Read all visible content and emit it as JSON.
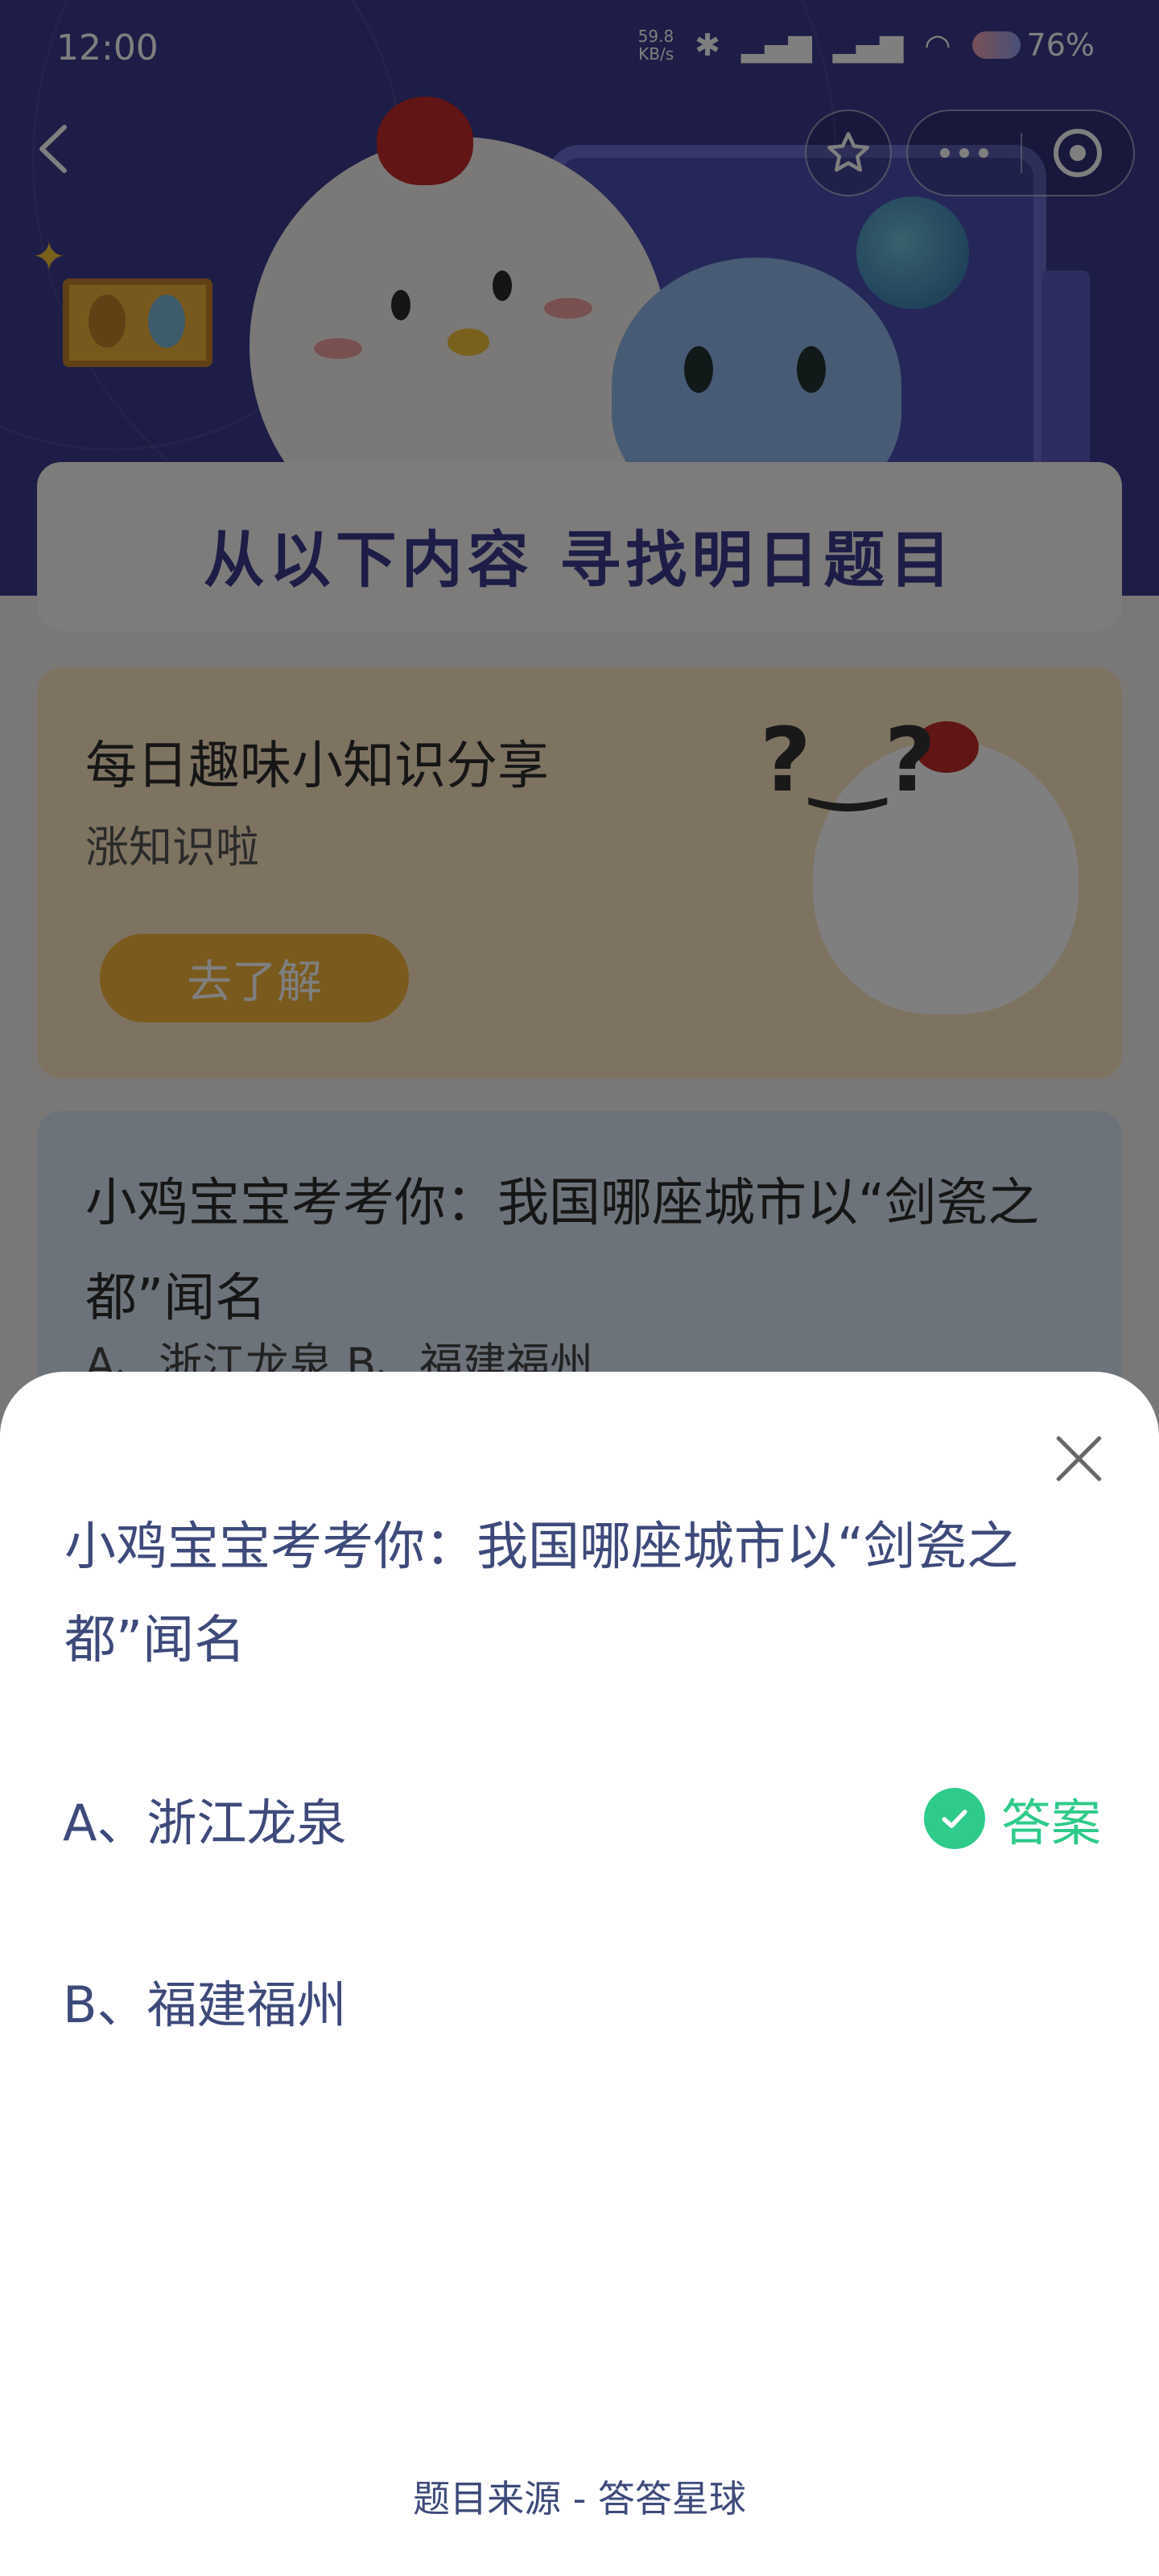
{
  "status_bar": {
    "time": "12:00",
    "net_speed_value": "59.8",
    "net_speed_unit": "KB/s",
    "battery": "76%"
  },
  "banner": {
    "title": "从以下内容  寻找明日题目"
  },
  "card_trivia": {
    "title": "每日趣味小知识分享",
    "subtitle": "涨知识啦",
    "button_label": "去了解"
  },
  "card_question": {
    "question": "小鸡宝宝考考你：我国哪座城市以“剑瓷之都”闻名",
    "options_preview": "A、浙江龙泉    B、福建福州"
  },
  "sheet": {
    "question": "小鸡宝宝考考你：我国哪座城市以“剑瓷之都”闻名",
    "options": [
      {
        "label": "A、浙江龙泉",
        "is_answer": true
      },
      {
        "label": "B、福建福州",
        "is_answer": false
      }
    ],
    "answer_label": "答案",
    "source": "题目来源 - 答答星球"
  },
  "colors": {
    "accent_green": "#2ecb8a",
    "text_navy": "#3d4a7a",
    "hero_purple": "#3a3a8e"
  }
}
